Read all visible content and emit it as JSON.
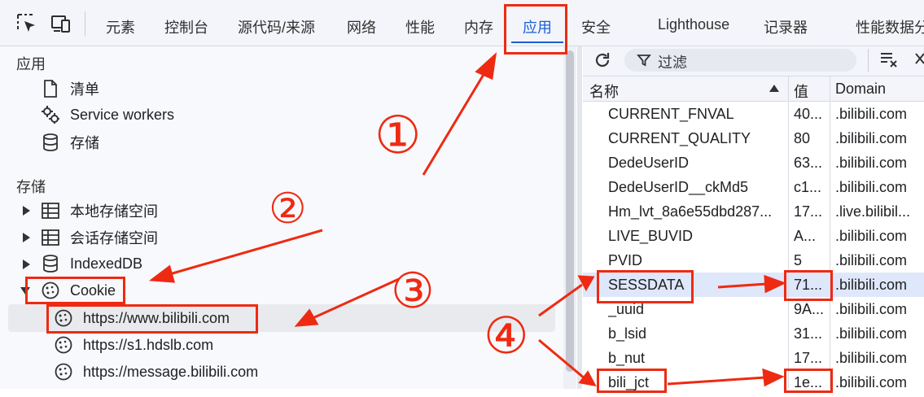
{
  "toolbar": {
    "tabs": [
      "元素",
      "控制台",
      "源代码/来源",
      "网络",
      "性能",
      "内存",
      "应用",
      "安全",
      "Lighthouse",
      "记录器",
      "性能数据分"
    ],
    "active_tab": "应用",
    "accent": "#1a5fd4"
  },
  "sidebar": {
    "app_section": "应用",
    "app_items": [
      "清单",
      "Service workers",
      "存储"
    ],
    "storage_section": "存储",
    "storage_items": [
      "本地存储空间",
      "会话存储空间",
      "IndexedDB",
      "Cookie"
    ],
    "cookie_items": [
      "https://www.bilibili.com",
      "https://s1.hdslb.com",
      "https://message.bilibili.com"
    ]
  },
  "cookie_panel": {
    "filter_placeholder": "过滤",
    "columns": [
      "名称",
      "值",
      "Domain"
    ],
    "rows": [
      {
        "name": "CURRENT_FNVAL",
        "value": "40...",
        "domain": ".bilibili.com"
      },
      {
        "name": "CURRENT_QUALITY",
        "value": "80",
        "domain": ".bilibili.com"
      },
      {
        "name": "DedeUserID",
        "value": "63...",
        "domain": ".bilibili.com"
      },
      {
        "name": "DedeUserID__ckMd5",
        "value": "c1...",
        "domain": ".bilibili.com"
      },
      {
        "name": "Hm_lvt_8a6e55dbd287...",
        "value": "17...",
        "domain": ".live.bilibil..."
      },
      {
        "name": "LIVE_BUVID",
        "value": "A...",
        "domain": ".bilibili.com"
      },
      {
        "name": "PVID",
        "value": "5",
        "domain": ".bilibili.com"
      },
      {
        "name": "SESSDATA",
        "value": "71...",
        "domain": ".bilibili.com"
      },
      {
        "name": "_uuid",
        "value": "9A...",
        "domain": ".bilibili.com"
      },
      {
        "name": "b_lsid",
        "value": "31...",
        "domain": ".bilibili.com"
      },
      {
        "name": "b_nut",
        "value": "17...",
        "domain": ".bilibili.com"
      },
      {
        "name": "bili_jct",
        "value": "1e...",
        "domain": ".bilibili.com"
      }
    ]
  },
  "annotations": {
    "color": "#ee2a12",
    "numbers": [
      "①",
      "②",
      "③",
      "④"
    ]
  }
}
